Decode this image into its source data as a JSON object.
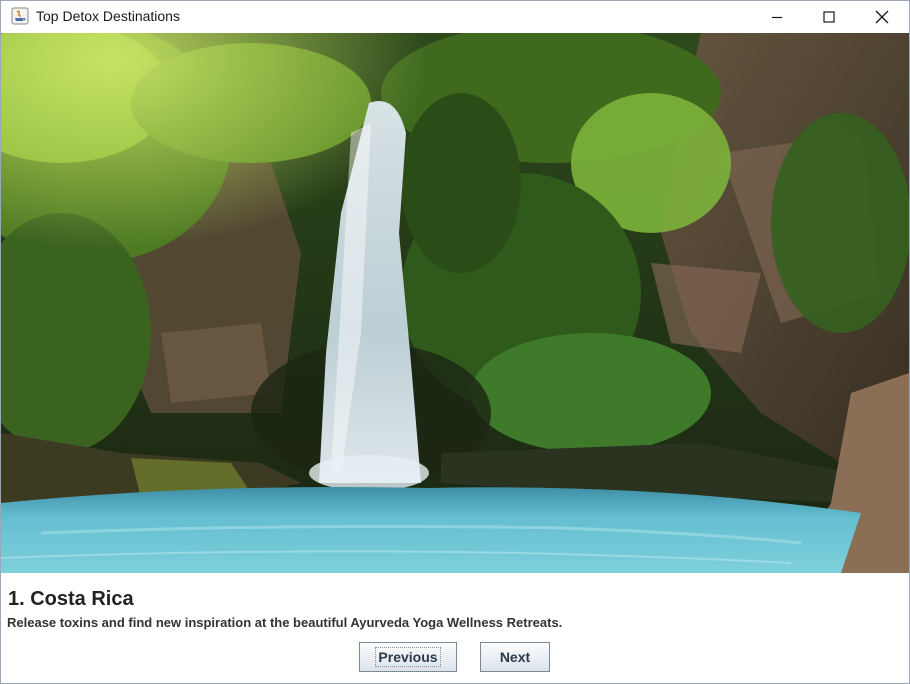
{
  "window": {
    "title": "Top Detox Destinations",
    "controls": {
      "minimize_icon": "minimize-icon",
      "maximize_icon": "maximize-icon",
      "close_icon": "close-icon"
    },
    "app_icon": "java-app-icon"
  },
  "destination": {
    "title": "1. Costa Rica",
    "description": "Release toxins and find new inspiration at the beautiful Ayurveda Yoga Wellness Retreats.",
    "image": "waterfall-lagoon-photo"
  },
  "navigation": {
    "previous_label": "Previous",
    "next_label": "Next"
  },
  "colors": {
    "window_border": "#9aa7b4",
    "title_text": "#1a1a1a",
    "button_border": "#7a8a99",
    "button_text": "#2b3b4b"
  }
}
